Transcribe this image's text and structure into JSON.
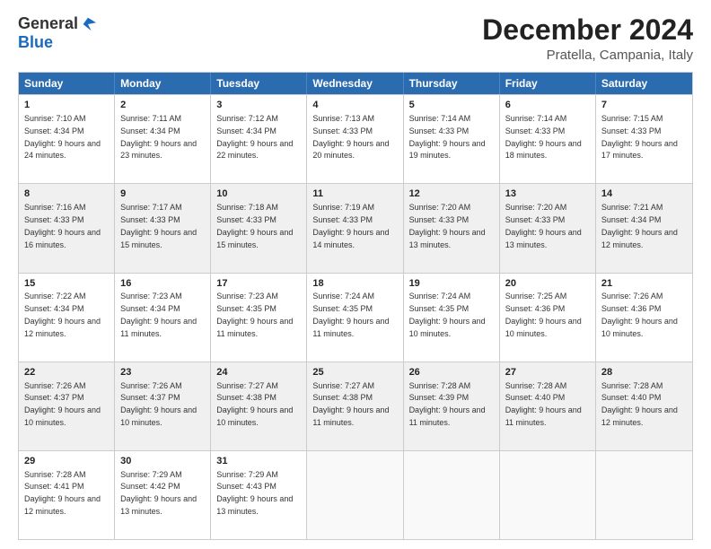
{
  "logo": {
    "general": "General",
    "blue": "Blue"
  },
  "title": "December 2024",
  "subtitle": "Pratella, Campania, Italy",
  "days": [
    "Sunday",
    "Monday",
    "Tuesday",
    "Wednesday",
    "Thursday",
    "Friday",
    "Saturday"
  ],
  "rows": [
    [
      {
        "day": "1",
        "sunrise": "7:10 AM",
        "sunset": "4:34 PM",
        "daylight": "9 hours and 24 minutes.",
        "shaded": false
      },
      {
        "day": "2",
        "sunrise": "7:11 AM",
        "sunset": "4:34 PM",
        "daylight": "9 hours and 23 minutes.",
        "shaded": false
      },
      {
        "day": "3",
        "sunrise": "7:12 AM",
        "sunset": "4:34 PM",
        "daylight": "9 hours and 22 minutes.",
        "shaded": false
      },
      {
        "day": "4",
        "sunrise": "7:13 AM",
        "sunset": "4:33 PM",
        "daylight": "9 hours and 20 minutes.",
        "shaded": false
      },
      {
        "day": "5",
        "sunrise": "7:14 AM",
        "sunset": "4:33 PM",
        "daylight": "9 hours and 19 minutes.",
        "shaded": false
      },
      {
        "day": "6",
        "sunrise": "7:14 AM",
        "sunset": "4:33 PM",
        "daylight": "9 hours and 18 minutes.",
        "shaded": false
      },
      {
        "day": "7",
        "sunrise": "7:15 AM",
        "sunset": "4:33 PM",
        "daylight": "9 hours and 17 minutes.",
        "shaded": false
      }
    ],
    [
      {
        "day": "8",
        "sunrise": "7:16 AM",
        "sunset": "4:33 PM",
        "daylight": "9 hours and 16 minutes.",
        "shaded": true
      },
      {
        "day": "9",
        "sunrise": "7:17 AM",
        "sunset": "4:33 PM",
        "daylight": "9 hours and 15 minutes.",
        "shaded": true
      },
      {
        "day": "10",
        "sunrise": "7:18 AM",
        "sunset": "4:33 PM",
        "daylight": "9 hours and 15 minutes.",
        "shaded": true
      },
      {
        "day": "11",
        "sunrise": "7:19 AM",
        "sunset": "4:33 PM",
        "daylight": "9 hours and 14 minutes.",
        "shaded": true
      },
      {
        "day": "12",
        "sunrise": "7:20 AM",
        "sunset": "4:33 PM",
        "daylight": "9 hours and 13 minutes.",
        "shaded": true
      },
      {
        "day": "13",
        "sunrise": "7:20 AM",
        "sunset": "4:33 PM",
        "daylight": "9 hours and 13 minutes.",
        "shaded": true
      },
      {
        "day": "14",
        "sunrise": "7:21 AM",
        "sunset": "4:34 PM",
        "daylight": "9 hours and 12 minutes.",
        "shaded": true
      }
    ],
    [
      {
        "day": "15",
        "sunrise": "7:22 AM",
        "sunset": "4:34 PM",
        "daylight": "9 hours and 12 minutes.",
        "shaded": false
      },
      {
        "day": "16",
        "sunrise": "7:23 AM",
        "sunset": "4:34 PM",
        "daylight": "9 hours and 11 minutes.",
        "shaded": false
      },
      {
        "day": "17",
        "sunrise": "7:23 AM",
        "sunset": "4:35 PM",
        "daylight": "9 hours and 11 minutes.",
        "shaded": false
      },
      {
        "day": "18",
        "sunrise": "7:24 AM",
        "sunset": "4:35 PM",
        "daylight": "9 hours and 11 minutes.",
        "shaded": false
      },
      {
        "day": "19",
        "sunrise": "7:24 AM",
        "sunset": "4:35 PM",
        "daylight": "9 hours and 10 minutes.",
        "shaded": false
      },
      {
        "day": "20",
        "sunrise": "7:25 AM",
        "sunset": "4:36 PM",
        "daylight": "9 hours and 10 minutes.",
        "shaded": false
      },
      {
        "day": "21",
        "sunrise": "7:26 AM",
        "sunset": "4:36 PM",
        "daylight": "9 hours and 10 minutes.",
        "shaded": false
      }
    ],
    [
      {
        "day": "22",
        "sunrise": "7:26 AM",
        "sunset": "4:37 PM",
        "daylight": "9 hours and 10 minutes.",
        "shaded": true
      },
      {
        "day": "23",
        "sunrise": "7:26 AM",
        "sunset": "4:37 PM",
        "daylight": "9 hours and 10 minutes.",
        "shaded": true
      },
      {
        "day": "24",
        "sunrise": "7:27 AM",
        "sunset": "4:38 PM",
        "daylight": "9 hours and 10 minutes.",
        "shaded": true
      },
      {
        "day": "25",
        "sunrise": "7:27 AM",
        "sunset": "4:38 PM",
        "daylight": "9 hours and 11 minutes.",
        "shaded": true
      },
      {
        "day": "26",
        "sunrise": "7:28 AM",
        "sunset": "4:39 PM",
        "daylight": "9 hours and 11 minutes.",
        "shaded": true
      },
      {
        "day": "27",
        "sunrise": "7:28 AM",
        "sunset": "4:40 PM",
        "daylight": "9 hours and 11 minutes.",
        "shaded": true
      },
      {
        "day": "28",
        "sunrise": "7:28 AM",
        "sunset": "4:40 PM",
        "daylight": "9 hours and 12 minutes.",
        "shaded": true
      }
    ],
    [
      {
        "day": "29",
        "sunrise": "7:28 AM",
        "sunset": "4:41 PM",
        "daylight": "9 hours and 12 minutes.",
        "shaded": false
      },
      {
        "day": "30",
        "sunrise": "7:29 AM",
        "sunset": "4:42 PM",
        "daylight": "9 hours and 13 minutes.",
        "shaded": false
      },
      {
        "day": "31",
        "sunrise": "7:29 AM",
        "sunset": "4:43 PM",
        "daylight": "9 hours and 13 minutes.",
        "shaded": false
      },
      {
        "day": "",
        "sunrise": "",
        "sunset": "",
        "daylight": "",
        "shaded": false,
        "empty": true
      },
      {
        "day": "",
        "sunrise": "",
        "sunset": "",
        "daylight": "",
        "shaded": false,
        "empty": true
      },
      {
        "day": "",
        "sunrise": "",
        "sunset": "",
        "daylight": "",
        "shaded": false,
        "empty": true
      },
      {
        "day": "",
        "sunrise": "",
        "sunset": "",
        "daylight": "",
        "shaded": false,
        "empty": true
      }
    ]
  ]
}
